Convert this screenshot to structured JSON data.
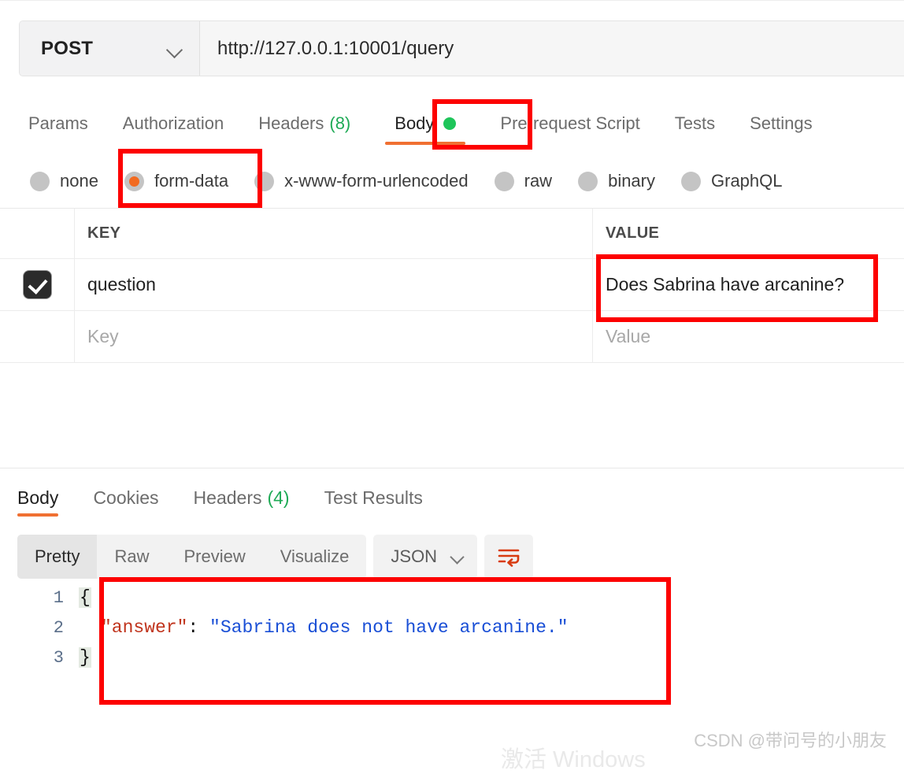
{
  "request": {
    "method": "POST",
    "method_chevron_icon": "chevron-down-icon",
    "url": "http://127.0.0.1:10001/query",
    "tabs": [
      {
        "label": "Params",
        "count": "",
        "active": false,
        "dot": false
      },
      {
        "label": "Authorization",
        "count": "",
        "active": false,
        "dot": false
      },
      {
        "label": "Headers",
        "count": "(8)",
        "active": false,
        "dot": false
      },
      {
        "label": "Body",
        "count": "",
        "active": true,
        "dot": true
      },
      {
        "label": "Pre-request Script",
        "count": "",
        "active": false,
        "dot": false
      },
      {
        "label": "Tests",
        "count": "",
        "active": false,
        "dot": false
      },
      {
        "label": "Settings",
        "count": "",
        "active": false,
        "dot": false
      }
    ],
    "body_types": [
      {
        "label": "none",
        "selected": false
      },
      {
        "label": "form-data",
        "selected": true
      },
      {
        "label": "x-www-form-urlencoded",
        "selected": false
      },
      {
        "label": "raw",
        "selected": false
      },
      {
        "label": "binary",
        "selected": false
      },
      {
        "label": "GraphQL",
        "selected": false
      }
    ],
    "table": {
      "headers": {
        "key": "KEY",
        "value": "VALUE"
      },
      "rows": [
        {
          "checked": true,
          "key": "question",
          "value": "Does Sabrina have arcanine?"
        }
      ],
      "empty_row": {
        "key_placeholder": "Key",
        "value_placeholder": "Value"
      }
    }
  },
  "response": {
    "tabs": [
      {
        "label": "Body",
        "count": "",
        "active": true
      },
      {
        "label": "Cookies",
        "count": "",
        "active": false
      },
      {
        "label": "Headers",
        "count": "(4)",
        "active": false
      },
      {
        "label": "Test Results",
        "count": "",
        "active": false
      }
    ],
    "view_modes": [
      {
        "label": "Pretty",
        "active": true
      },
      {
        "label": "Raw",
        "active": false
      },
      {
        "label": "Preview",
        "active": false
      },
      {
        "label": "Visualize",
        "active": false
      }
    ],
    "format": "JSON",
    "format_chevron_icon": "chevron-down-icon",
    "wrap_icon": "wrap-text-icon",
    "code": {
      "lines": [
        {
          "num": "1",
          "open_brace": "{",
          "key": "",
          "colon": "",
          "string": "",
          "close_brace": ""
        },
        {
          "num": "2",
          "open_brace": "",
          "key": "\"answer\"",
          "colon": ": ",
          "string": "\"Sabrina does not have arcanine.\"",
          "close_brace": ""
        },
        {
          "num": "3",
          "open_brace": "",
          "key": "",
          "colon": "",
          "string": "",
          "close_brace": "}"
        }
      ]
    }
  },
  "annotations": {
    "body_tab_highlight": "",
    "form_data_highlight": "",
    "value_cell_highlight": "",
    "json_body_highlight": ""
  },
  "watermarks": {
    "csdn": "CSDN @带问号的小朋友",
    "windows": "激活 Windows"
  },
  "colors": {
    "accent_orange": "#f07032",
    "radio_orange": "#f26b21",
    "annotation_red": "#fd0000",
    "green_dot": "#1ec55a",
    "count_green": "#1faa56",
    "json_key": "#c0341d",
    "json_string": "#1a4fd6"
  }
}
